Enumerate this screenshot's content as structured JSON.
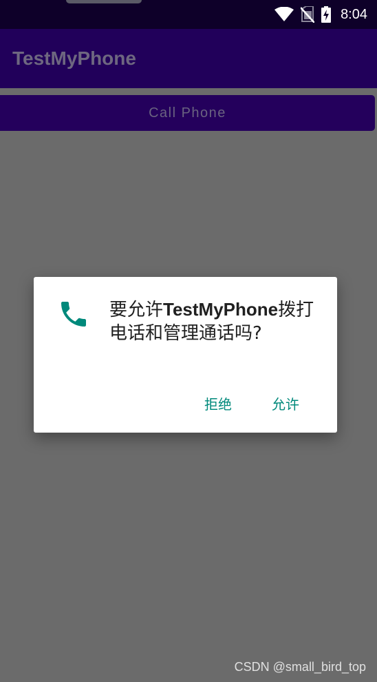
{
  "status_bar": {
    "time": "8:04",
    "icons": [
      "wifi-icon",
      "no-sim-icon",
      "battery-charging-icon"
    ]
  },
  "app_bar": {
    "title": "TestMyPhone"
  },
  "main": {
    "call_button_label": "Call Phone"
  },
  "dialog": {
    "icon": "phone-icon",
    "message_prefix": "要允许",
    "app_name": "TestMyPhone",
    "message_suffix": "拨打电话和管理通话吗?",
    "deny_label": "拒绝",
    "allow_label": "允许"
  },
  "watermark": "CSDN @small_bird_top",
  "colors": {
    "status_bar": "#0e0029",
    "app_bar": "#21005a",
    "scrim": "#6b6b6b",
    "accent": "#00897b"
  }
}
